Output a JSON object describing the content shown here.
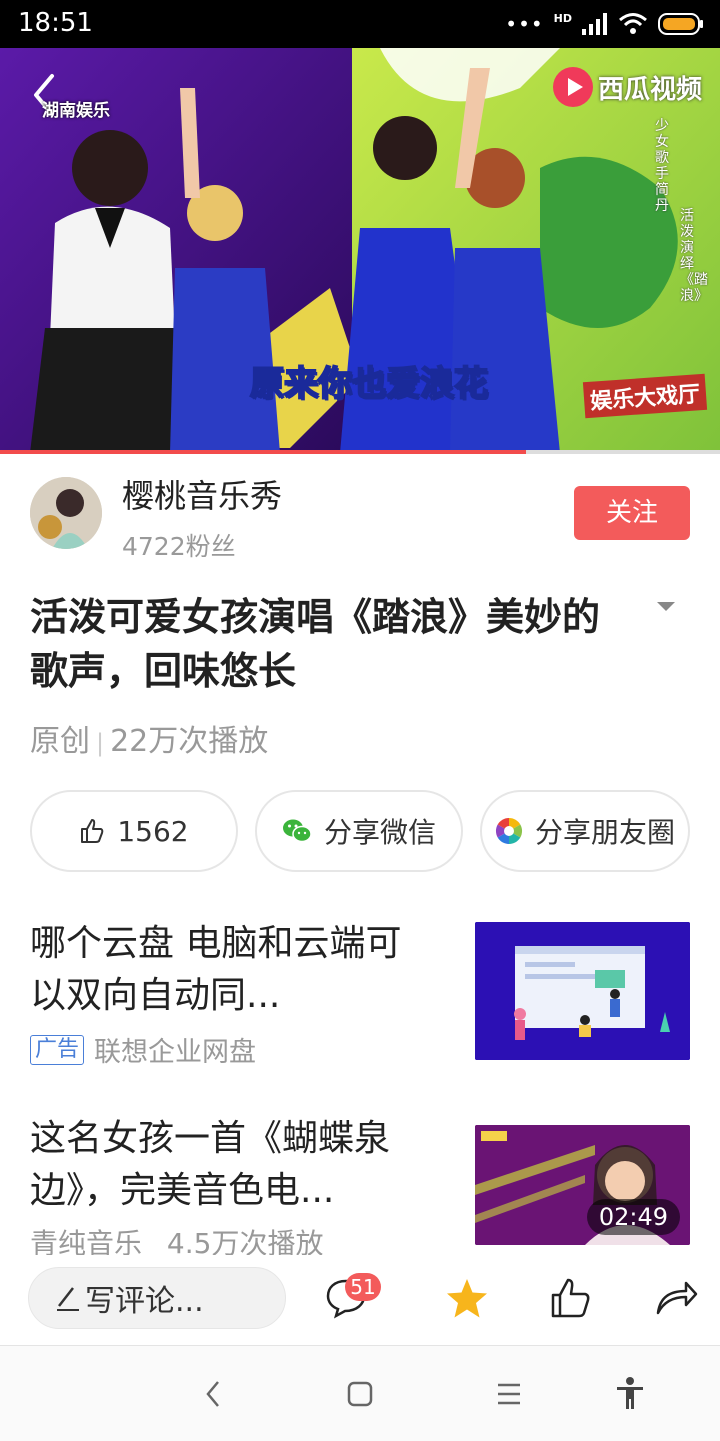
{
  "status_bar": {
    "time": "18:51",
    "network_label": "HD"
  },
  "video": {
    "channel_logo": "湖南娱乐",
    "watermark": "西瓜视频",
    "subtitle": "原来你也爱浪花",
    "side_caption_1": "少女歌手简丹",
    "side_caption_2": "活泼演绎《踏浪》",
    "show_logo": "娱乐大戏厅",
    "progress": 0.73
  },
  "author": {
    "name": "樱桃音乐秀",
    "fans": "4722粉丝",
    "follow_label": "关注"
  },
  "article": {
    "title": "活泼可爱女孩演唱《踏浪》美妙的歌声，回味悠长",
    "source": "原创",
    "separator": "|",
    "plays": "22万次播放"
  },
  "actions": {
    "likes": "1562",
    "share_wechat": "分享微信",
    "share_moments": "分享朋友圈"
  },
  "feed": [
    {
      "title": "哪个云盘 电脑和云端可以双向自动同...",
      "ad_label": "广告",
      "source": "联想企业网盘"
    },
    {
      "title": "这名女孩一首《蝴蝶泉边》，完美音色电...",
      "source": "青纯音乐",
      "plays": "4.5万次播放",
      "duration": "02:49"
    }
  ],
  "comment_bar": {
    "placeholder": "写评论...",
    "comment_count": "51"
  },
  "colors": {
    "accent": "#f35b5b",
    "ad_blue": "#4a7fd8",
    "star": "#f7b51c"
  },
  "icons": [
    "back-icon",
    "like-icon",
    "wechat-icon",
    "moments-icon",
    "pencil-icon",
    "comment-icon",
    "star-icon",
    "thumb-up-icon",
    "share-icon",
    "nav-back-icon",
    "nav-home-icon",
    "nav-menu-icon",
    "accessibility-icon",
    "expand-icon"
  ]
}
